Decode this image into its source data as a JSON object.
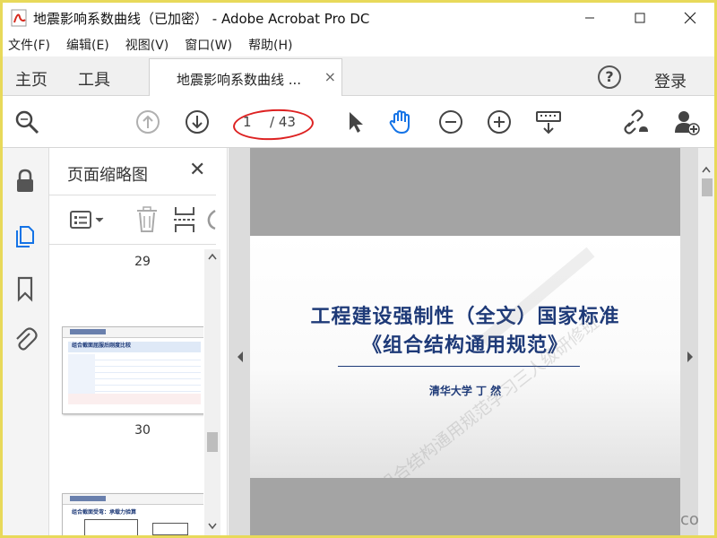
{
  "window": {
    "title": "地震影响系数曲线（已加密） - Adobe Acrobat Pro DC",
    "buttons": [
      "minimize",
      "maximize",
      "close"
    ]
  },
  "menu": [
    "文件(F)",
    "编辑(E)",
    "视图(V)",
    "窗口(W)",
    "帮助(H)"
  ],
  "tabs": {
    "home": "主页",
    "tools": "工具",
    "document": "地震影响系数曲线 ...",
    "close_glyph": "×",
    "help_glyph": "?",
    "login": "登录"
  },
  "toolbar": {
    "current_page": "1",
    "total_pages": "/ 43",
    "icons": [
      "find-icon",
      "previous-page-icon",
      "next-page-icon",
      "select-cursor-icon",
      "hand-tool-icon",
      "zoom-out-icon",
      "zoom-in-icon",
      "keyboard-marquee-icon",
      "share-link-icon",
      "add-user-icon"
    ],
    "annotation_color": "#d22222"
  },
  "leftrail": {
    "icons": [
      "lock-icon",
      "page-thumbnails-icon",
      "bookmark-icon",
      "attachment-icon"
    ],
    "active_color": "#1473e6"
  },
  "thumbnails_panel": {
    "title": "页面缩略图",
    "close_glyph": "✕",
    "page_labels": [
      "29",
      "30"
    ],
    "thumb_30_heading": "组合截面屈服后刚度比较",
    "thumb_31_heading": "组合截面受弯：承载力验算"
  },
  "document": {
    "title_line1": "工程建设强制性（全文）国家标准",
    "title_line2": "《组合结构通用规范》",
    "author": "清华大学 丁 然",
    "watermark": "组合结构通用规范学习三人级研修班",
    "watermark_tail": "com",
    "title_color": "#1e3a78"
  }
}
